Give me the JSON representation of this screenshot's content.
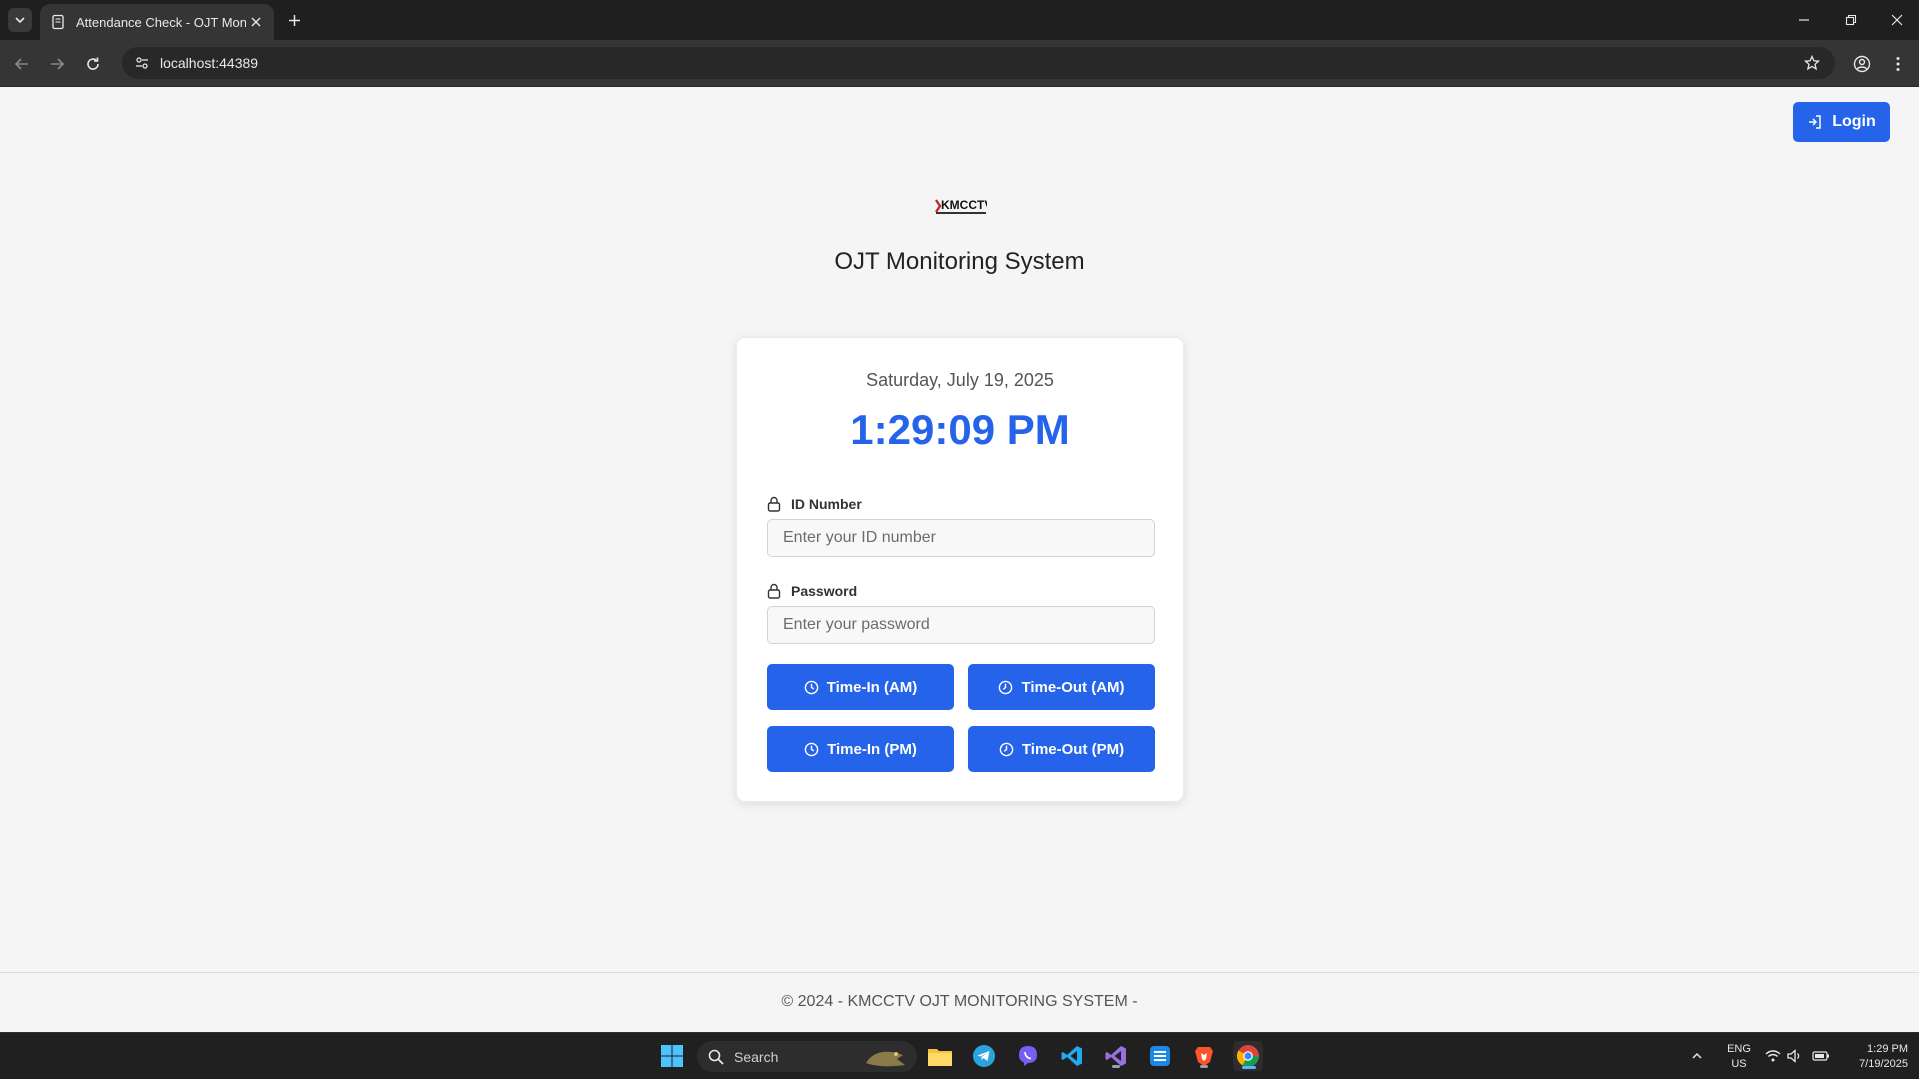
{
  "browser": {
    "tab_title": "Attendance Check - OJT Monitoring System",
    "url": "localhost:44389"
  },
  "header": {
    "login_label": "Login"
  },
  "brand": {
    "logo_text": "KMCCTV",
    "title": "OJT Monitoring System"
  },
  "clock_card": {
    "date": "Saturday, July 19, 2025",
    "time": "1:29:09 PM"
  },
  "form": {
    "id_label": "ID Number",
    "id_placeholder": "Enter your ID number",
    "password_label": "Password",
    "password_placeholder": "Enter your password"
  },
  "actions": {
    "time_in_am": "Time-In (AM)",
    "time_out_am": "Time-Out (AM)",
    "time_in_pm": "Time-In (PM)",
    "time_out_pm": "Time-Out (PM)"
  },
  "footer": {
    "text": "© 2024 - KMCCTV OJT MONITORING SYSTEM -"
  },
  "taskbar": {
    "search_label": "Search",
    "lang_line1": "ENG",
    "lang_line2": "US",
    "clock_time": "1:29 PM",
    "clock_date": "7/19/2025"
  },
  "colors": {
    "accent": "#2563eb",
    "page_bg": "#f5f5f5",
    "chrome_bg": "#1f1f1f"
  }
}
